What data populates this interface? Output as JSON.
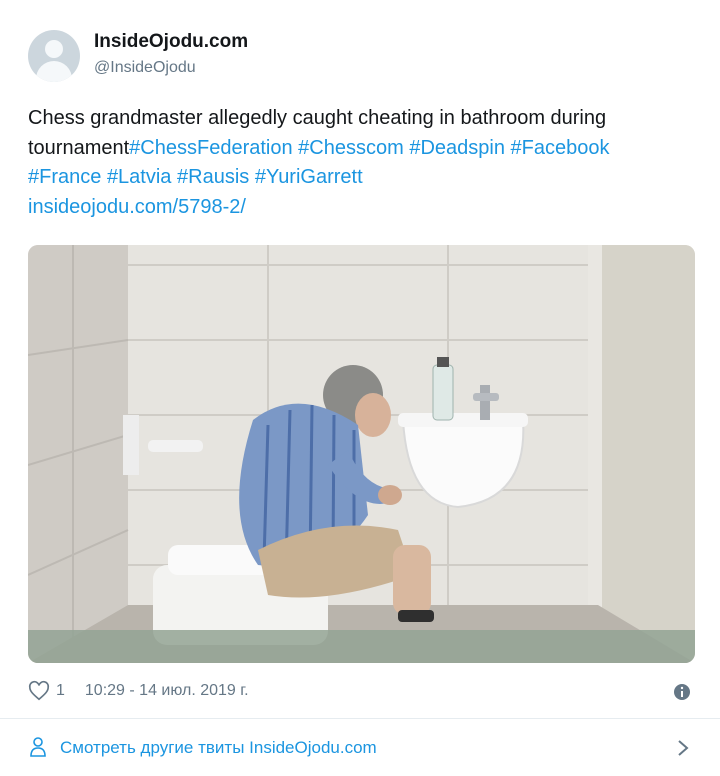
{
  "author": {
    "name": "InsideOjodu.com",
    "handle": "@InsideOjodu"
  },
  "tweet": {
    "text_plain": "Chess grandmaster allegedly caught cheating in bathroom during tournament",
    "hashtags": [
      "#ChessFederation",
      "#Chesscom",
      "#Deadspin",
      "#Facebook",
      "#France",
      "#Latvia",
      "#Rausis",
      "#YuriGarrett"
    ],
    "link": "insideojodu.com/5798-2/"
  },
  "footer": {
    "likes": "1",
    "timestamp": "10:29 - 14 июл. 2019 г."
  },
  "more_tweets": {
    "label": "Смотреть другие твиты InsideOjodu.com"
  },
  "colors": {
    "link": "#1b95e0",
    "text": "#14171a",
    "secondary": "#657786",
    "divider": "#e6ecf0"
  },
  "icons": [
    "avatar-placeholder",
    "heart-icon",
    "info-icon",
    "person-icon",
    "chevron-right-icon"
  ]
}
